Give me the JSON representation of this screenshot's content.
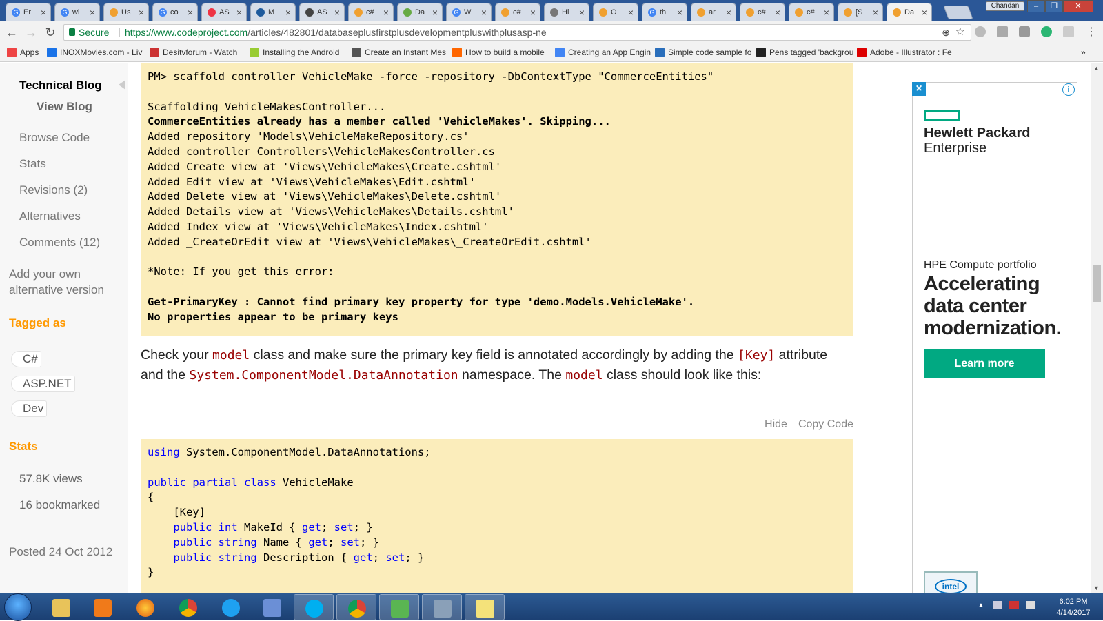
{
  "browser": {
    "tabs": [
      {
        "label": "Er",
        "color": "#4285f4",
        "glyph": "G"
      },
      {
        "label": "wi",
        "color": "#4285f4",
        "glyph": "G"
      },
      {
        "label": "Us",
        "color": "#f0a030",
        "glyph": ""
      },
      {
        "label": "co",
        "color": "#4285f4",
        "glyph": "G"
      },
      {
        "label": "AS",
        "color": "#e34",
        "glyph": ""
      },
      {
        "label": "M",
        "color": "#1e5a9c",
        "glyph": ""
      },
      {
        "label": "AS",
        "color": "#444",
        "glyph": ""
      },
      {
        "label": "c#",
        "color": "#f0a030",
        "glyph": ""
      },
      {
        "label": "Da",
        "color": "#6a4",
        "glyph": ""
      },
      {
        "label": "W",
        "color": "#4285f4",
        "glyph": "G"
      },
      {
        "label": "c#",
        "color": "#f0a030",
        "glyph": ""
      },
      {
        "label": "Hi",
        "color": "#777",
        "glyph": ""
      },
      {
        "label": "O",
        "color": "#f0a030",
        "glyph": ""
      },
      {
        "label": "th",
        "color": "#4285f4",
        "glyph": "G"
      },
      {
        "label": "ar",
        "color": "#f0a030",
        "glyph": ""
      },
      {
        "label": "c#",
        "color": "#f0a030",
        "glyph": ""
      },
      {
        "label": "c#",
        "color": "#f0a030",
        "glyph": ""
      },
      {
        "label": "[S",
        "color": "#f0a030",
        "glyph": ""
      },
      {
        "label": "Da",
        "color": "#f0a030",
        "glyph": ""
      }
    ],
    "user": "Chandan",
    "secure_label": "Secure",
    "url_host": "https://www.codeproject.com",
    "url_path": "/articles/482801/databaseplusfirstplusdevelopmentpluswithplusasp-ne",
    "bookmarks": [
      {
        "label": "Apps",
        "color": "#e44"
      },
      {
        "label": "INOXMovies.com - Liv",
        "color": "#1a73e8"
      },
      {
        "label": "Desitvforum - Watch",
        "color": "#c33"
      },
      {
        "label": "Installing the Android",
        "color": "#9c3"
      },
      {
        "label": "Create an Instant Mes",
        "color": "#555"
      },
      {
        "label": "How to build a mobile",
        "color": "#f60"
      },
      {
        "label": "Creating an App Engin",
        "color": "#4285f4"
      },
      {
        "label": "Simple code sample fo",
        "color": "#2a6ebb"
      },
      {
        "label": "Pens tagged 'backgrou",
        "color": "#222"
      },
      {
        "label": "Adobe - Illustrator : Fe",
        "color": "#d00"
      }
    ],
    "more": "»"
  },
  "sidebar": {
    "title": "Technical Blog",
    "view_blog": "View Blog",
    "links": [
      "Browse Code",
      "Stats",
      "Revisions (2)",
      "Alternatives",
      "Comments (12)"
    ],
    "add_alt_line1": "Add your own",
    "add_alt_line2": "alternative version",
    "tagged_as": "Tagged as",
    "tags": [
      "C#",
      "ASP.NET",
      "Dev"
    ],
    "stats_heading": "Stats",
    "views": "57.8K views",
    "bookmarked": "16 bookmarked",
    "posted": "Posted 24 Oct 2012"
  },
  "article": {
    "console_lines": [
      {
        "text": "PM> scaffold controller VehicleMake -force -repository -DbContextType \"CommerceEntities\"",
        "bold": false
      },
      {
        "text": "",
        "bold": false
      },
      {
        "text": "Scaffolding VehicleMakesController...",
        "bold": false
      },
      {
        "text": "CommerceEntities already has a member called 'VehicleMakes'. Skipping...",
        "bold": true
      },
      {
        "text": "Added repository 'Models\\VehicleMakeRepository.cs'",
        "bold": false
      },
      {
        "text": "Added controller Controllers\\VehicleMakesController.cs",
        "bold": false
      },
      {
        "text": "Added Create view at 'Views\\VehicleMakes\\Create.cshtml'",
        "bold": false
      },
      {
        "text": "Added Edit view at 'Views\\VehicleMakes\\Edit.cshtml'",
        "bold": false
      },
      {
        "text": "Added Delete view at 'Views\\VehicleMakes\\Delete.cshtml'",
        "bold": false
      },
      {
        "text": "Added Details view at 'Views\\VehicleMakes\\Details.cshtml'",
        "bold": false
      },
      {
        "text": "Added Index view at 'Views\\VehicleMakes\\Index.cshtml'",
        "bold": false
      },
      {
        "text": "Added _CreateOrEdit view at 'Views\\VehicleMakes\\_CreateOrEdit.cshtml'",
        "bold": false
      },
      {
        "text": "",
        "bold": false
      },
      {
        "text": "*Note: If you get this error:",
        "bold": false
      },
      {
        "text": "",
        "bold": false
      },
      {
        "text": "Get-PrimaryKey : Cannot find primary key property for type 'demo.Models.VehicleMake'.",
        "bold": true
      },
      {
        "text": "No properties appear to be primary keys",
        "bold": true
      }
    ],
    "para": {
      "t1": "Check your ",
      "c1": "model",
      "t2": " class and make sure the primary key field is annotated accordingly by adding the ",
      "c2": "[Key]",
      "t3": " attribute and the ",
      "c3": "System.ComponentModel.DataAnnotation",
      "t4": " namespace. The ",
      "c4": "model",
      "t5": " class should look like this:"
    },
    "hide_label": "Hide",
    "copy_label": "Copy Code",
    "code_lines": [
      [
        {
          "t": "using",
          "k": true
        },
        {
          "t": " System.ComponentModel.DataAnnotations;",
          "k": false
        }
      ],
      [],
      [
        {
          "t": "public",
          "k": true
        },
        {
          "t": " ",
          "k": false
        },
        {
          "t": "partial",
          "k": true
        },
        {
          "t": " ",
          "k": false
        },
        {
          "t": "class",
          "k": true
        },
        {
          "t": " VehicleMake",
          "k": false
        }
      ],
      [
        {
          "t": "{",
          "k": false
        }
      ],
      [
        {
          "t": "    [Key]",
          "k": false
        }
      ],
      [
        {
          "t": "    ",
          "k": false
        },
        {
          "t": "public",
          "k": true
        },
        {
          "t": " ",
          "k": false
        },
        {
          "t": "int",
          "k": true
        },
        {
          "t": " MakeId { ",
          "k": false
        },
        {
          "t": "get",
          "k": true
        },
        {
          "t": "; ",
          "k": false
        },
        {
          "t": "set",
          "k": true
        },
        {
          "t": "; }",
          "k": false
        }
      ],
      [
        {
          "t": "    ",
          "k": false
        },
        {
          "t": "public",
          "k": true
        },
        {
          "t": " ",
          "k": false
        },
        {
          "t": "string",
          "k": true
        },
        {
          "t": " Name { ",
          "k": false
        },
        {
          "t": "get",
          "k": true
        },
        {
          "t": "; ",
          "k": false
        },
        {
          "t": "set",
          "k": true
        },
        {
          "t": "; }",
          "k": false
        }
      ],
      [
        {
          "t": "    ",
          "k": false
        },
        {
          "t": "public",
          "k": true
        },
        {
          "t": " ",
          "k": false
        },
        {
          "t": "string",
          "k": true
        },
        {
          "t": " Description { ",
          "k": false
        },
        {
          "t": "get",
          "k": true
        },
        {
          "t": "; ",
          "k": false
        },
        {
          "t": "set",
          "k": true
        },
        {
          "t": "; }",
          "k": false
        }
      ],
      [
        {
          "t": "}",
          "k": false
        }
      ]
    ]
  },
  "ad": {
    "brand_line1": "Hewlett Packard",
    "brand_line2": "Enterprise",
    "subtitle": "HPE Compute portfolio",
    "headline": "Accelerating data center modernization.",
    "cta": "Learn more",
    "intel": "intel",
    "accent": "#01a982"
  },
  "taskbar": {
    "time": "6:02 PM",
    "date": "4/14/2017"
  }
}
